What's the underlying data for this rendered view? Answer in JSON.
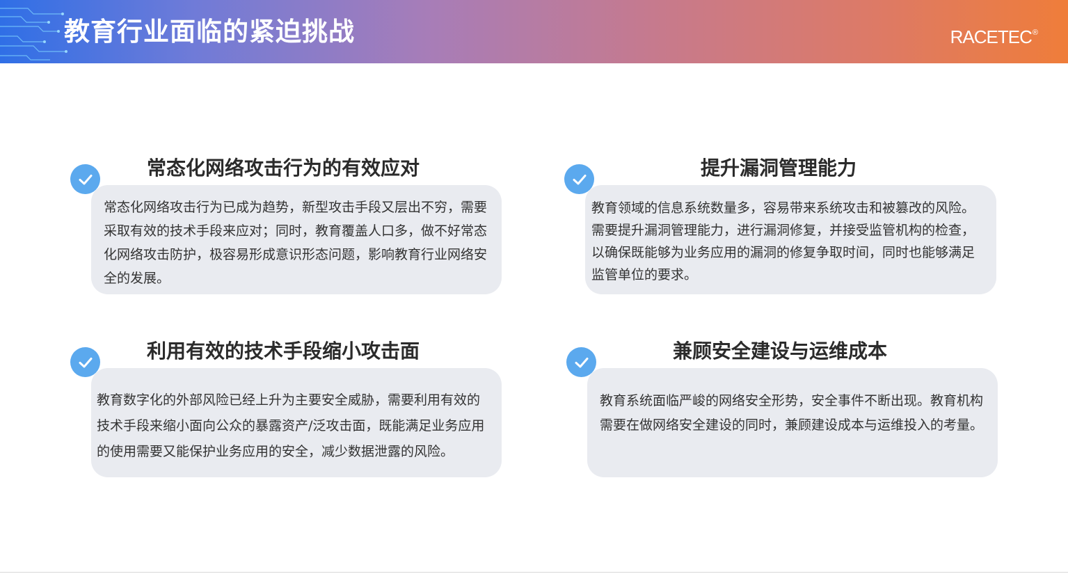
{
  "header": {
    "title": "教育行业面临的紧迫挑战",
    "logo": "RACETEC",
    "logo_mark": "®",
    "gradient": [
      "#2f6fe6",
      "#a77db8",
      "#ef7d3a"
    ]
  },
  "accent_color": "#5ba9ee",
  "panel_color": "#e9ebf0",
  "cards": [
    {
      "title": "常态化网络攻击行为的有效应对",
      "body": "常态化网络攻击行为已成为趋势，新型攻击手段又层出不穷，需要采取有效的技术手段来应对；同时，教育覆盖人口多，做不好常态化网络攻击防护，极容易形成意识形态问题，影响教育行业网络安全的发展。",
      "icon": "check-icon"
    },
    {
      "title": "提升漏洞管理能力",
      "body": "教育领域的信息系统数量多，容易带来系统攻击和被篡改的风险。需要提升漏洞管理能力，进行漏洞修复，并接受监管机构的检查，以确保既能够为业务应用的漏洞的修复争取时间，同时也能够满足监管单位的要求。",
      "icon": "check-icon"
    },
    {
      "title": "利用有效的技术手段缩小攻击面",
      "body": "教育数字化的外部风险已经上升为主要安全威胁，需要利用有效的技术手段来缩小面向公众的暴露资产/泛攻击面，既能满足业务应用的使用需要又能保护业务应用的安全，减少数据泄露的风险。",
      "icon": "check-icon"
    },
    {
      "title": "兼顾安全建设与运维成本",
      "body": "教育系统面临严峻的网络安全形势，安全事件不断出现。教育机构需要在做网络安全建设的同时，兼顾建设成本与运维投入的考量。",
      "icon": "check-icon"
    }
  ]
}
